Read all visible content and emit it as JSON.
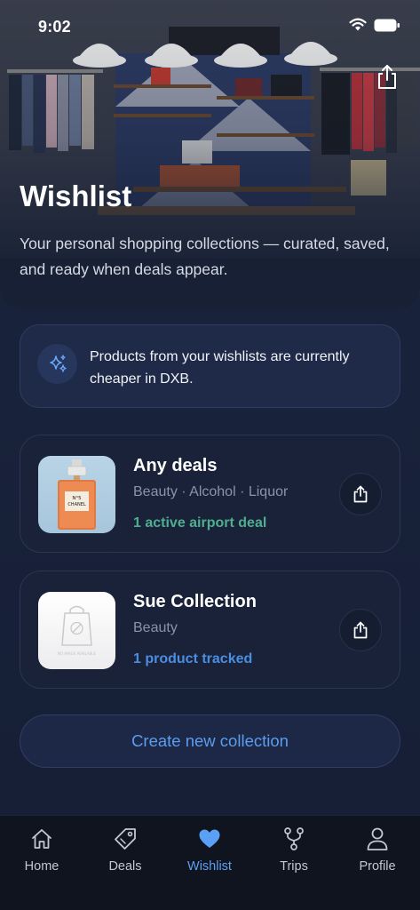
{
  "status_bar": {
    "time": "9:02"
  },
  "hero": {
    "title": "Wishlist",
    "subtitle": "Your personal shopping collections — curated, saved, and ready when deals appear."
  },
  "info_banner": {
    "text": "Products from your wishlists are currently cheaper in DXB.",
    "icon": "sparkles-icon"
  },
  "collections": [
    {
      "title": "Any deals",
      "meta": "Beauty · Alcohol · Liquor",
      "status": "1 active airport deal",
      "status_color": "#4fae8f",
      "thumb_label_1": "N°5",
      "thumb_label_2": "CHANEL"
    },
    {
      "title": "Sue Collection",
      "meta": "Beauty",
      "status": "1 product tracked",
      "status_color": "#4b8de0",
      "thumb_label": "NO IMAGE AVAILABLE"
    }
  ],
  "create_button": {
    "label": "Create new collection"
  },
  "tab_bar": {
    "items": [
      {
        "label": "Home",
        "icon": "home-icon",
        "active": false
      },
      {
        "label": "Deals",
        "icon": "tag-icon",
        "active": false
      },
      {
        "label": "Wishlist",
        "icon": "heart-icon",
        "active": true
      },
      {
        "label": "Trips",
        "icon": "route-icon",
        "active": false
      },
      {
        "label": "Profile",
        "icon": "person-icon",
        "active": false
      }
    ]
  },
  "colors": {
    "accent": "#5aa0f5",
    "background": "#141d33",
    "card": "#192239",
    "tab_bar": "#10141f"
  }
}
